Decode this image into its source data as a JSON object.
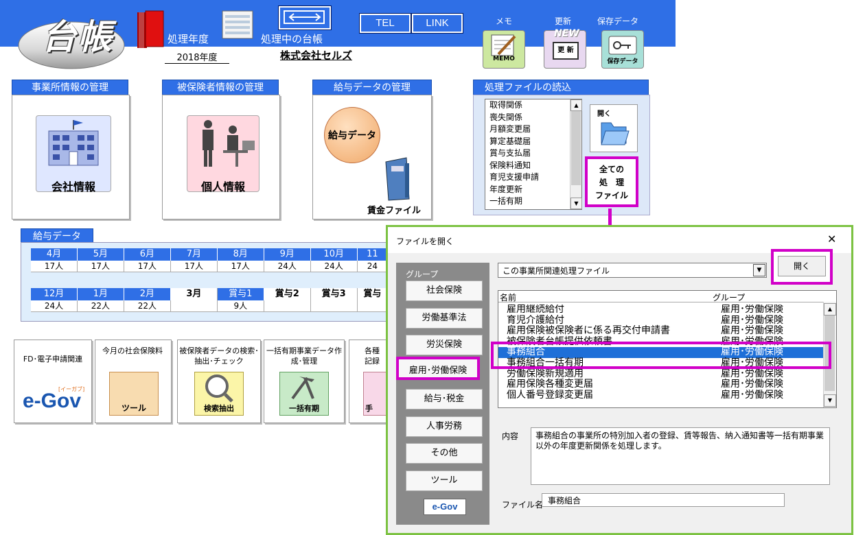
{
  "header": {
    "logo_text": "台帳",
    "fiscal_year_label": "処理年度",
    "fiscal_year_value": "2018年度",
    "current_ledger_label": "処理中の台帳",
    "current_ledger_value": "株式会社セルズ",
    "tel_button": "TEL",
    "link_button": "LINK",
    "memo_label": "メモ",
    "memo_icon_text": "MEMO",
    "update_label": "更新",
    "update_icon_new": "NEW",
    "update_icon_text": "更 新",
    "save_label": "保存データ",
    "save_icon_text": "保存データ"
  },
  "panels": {
    "office": {
      "title": "事業所情報の管理",
      "button": "会社情報"
    },
    "insured": {
      "title": "被保険者情報の管理",
      "button": "個人情報"
    },
    "salary": {
      "title": "給与データの管理",
      "button": "給与データ",
      "file_label": "賃金ファイル"
    },
    "files": {
      "title": "処理ファイルの読込",
      "items": [
        "取得関係",
        "喪失関係",
        "月額変更届",
        "算定基礎届",
        "賞与支払届",
        "保険料通知",
        "育児支援申請",
        "年度更新",
        "一括有期"
      ],
      "open_label": "開く",
      "all_files_line1": "全ての",
      "all_files_line2": "処　理",
      "all_files_line3": "ファイル"
    }
  },
  "salary_grid": {
    "title": "給与データ",
    "row1": {
      "headers": [
        "4月",
        "5月",
        "6月",
        "7月",
        "8月",
        "9月",
        "10月",
        "11"
      ],
      "values": [
        "17人",
        "17人",
        "17人",
        "17人",
        "17人",
        "24人",
        "24人",
        "24"
      ]
    },
    "row2": {
      "headers": [
        "12月",
        "1月",
        "2月",
        "3月",
        "賞与1",
        "賞与2",
        "賞与3",
        "賞与"
      ],
      "values": [
        "24人",
        "22人",
        "22人",
        "",
        "9人",
        "",
        "",
        ""
      ]
    }
  },
  "tiles": {
    "egov": {
      "label": "FD･電子申請関連",
      "logo": "e-Gov",
      "logo_sub": "[イーガブ]"
    },
    "monthly": {
      "label": "今月の社会保険料",
      "icon_text": "ツール"
    },
    "search": {
      "label": "被保険者データの検索･抽出･チェック",
      "icon_text": "検索抽出"
    },
    "lump": {
      "label": "一括有期事業データ作成･管理",
      "icon_text": "一括有期"
    },
    "misc": {
      "label": "各種記録",
      "icon_text": "手"
    }
  },
  "dialog": {
    "title": "ファイルを開く",
    "close": "✕",
    "group_label": "グループ",
    "groups": [
      "社会保険",
      "労働基準法",
      "労災保険",
      "雇用･労働保険",
      "給与･税金",
      "人事労務",
      "その他",
      "ツール"
    ],
    "egov_logo": "e-Gov",
    "dropdown_value": "この事業所関連処理ファイル",
    "open_button": "開く",
    "col_name": "名前",
    "col_group": "グループ",
    "rows": [
      {
        "name": "雇用継続給付",
        "group": "雇用･労働保険"
      },
      {
        "name": "育児介護給付",
        "group": "雇用･労働保険"
      },
      {
        "name": "雇用保険被保険者に係る再交付申請書",
        "group": "雇用･労働保険"
      },
      {
        "name": "被保険者台帳提供依頼書",
        "group": "雇用･労働保険"
      },
      {
        "name": "事務組合",
        "group": "雇用･労働保険"
      },
      {
        "name": "事務組合一括有期",
        "group": "雇用･労働保険"
      },
      {
        "name": "労働保険新規適用",
        "group": "雇用･労働保険"
      },
      {
        "name": "雇用保険各種変更届",
        "group": "雇用･労働保険"
      },
      {
        "name": "個人番号登録変更届",
        "group": "雇用･労働保険"
      }
    ],
    "content_label": "内容",
    "content_text": "事務組合の事業所の特別加入者の登録、賃等報告、納入通知書等一括有期事業以外の年度更新関係を処理します。",
    "filename_label": "ファイル名",
    "filename_value": "事務組合"
  }
}
